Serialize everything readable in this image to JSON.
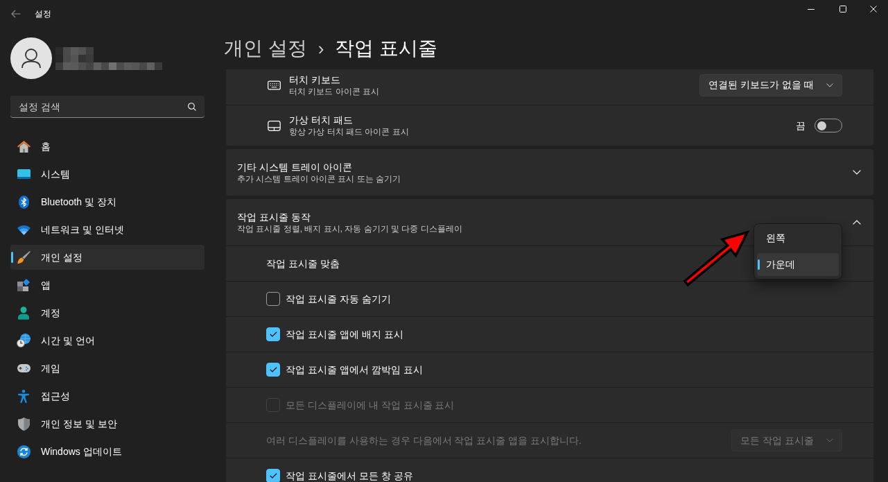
{
  "window": {
    "title": "설정"
  },
  "search": {
    "placeholder": "설정 검색"
  },
  "sidebar": {
    "items": [
      {
        "label": "홈",
        "selected": false
      },
      {
        "label": "시스템",
        "selected": false
      },
      {
        "label": "Bluetooth 및 장치",
        "selected": false
      },
      {
        "label": "네트워크 및 인터넷",
        "selected": false
      },
      {
        "label": "개인 설정",
        "selected": true
      },
      {
        "label": "앱",
        "selected": false
      },
      {
        "label": "계정",
        "selected": false
      },
      {
        "label": "시간 및 언어",
        "selected": false
      },
      {
        "label": "게임",
        "selected": false
      },
      {
        "label": "접근성",
        "selected": false
      },
      {
        "label": "개인 정보 및 보안",
        "selected": false
      },
      {
        "label": "Windows 업데이트",
        "selected": false
      }
    ]
  },
  "breadcrumb": {
    "parent": "개인 설정",
    "separator": "›",
    "current": "작업 표시줄"
  },
  "cards": [
    {
      "kind": "group",
      "rows": [
        {
          "kind": "select",
          "title": "터치 키보드",
          "subtitle": "터치 키보드 아이콘 표시",
          "value": "연결된 키보드가 없을 때"
        },
        {
          "kind": "toggle",
          "title": "가상 터치 패드",
          "subtitle": "항상 가상 터치 패드 아이콘 표시",
          "state_label": "끔",
          "on": false
        }
      ]
    },
    {
      "kind": "expander",
      "title": "기타 시스템 트레이 아이콘",
      "subtitle": "추가 시스템 트레이 아이콘 표시 또는 숨기기",
      "expanded": false
    },
    {
      "kind": "expander",
      "title": "작업 표시줄 동작",
      "subtitle": "작업 표시줄 정렬, 배지 표시, 자동 숨기기 및 다중 디스플레이",
      "expanded": true,
      "rows": [
        {
          "kind": "select",
          "title": "작업 표시줄 맞춤",
          "disabled": false,
          "menu": {
            "open": true,
            "options": [
              {
                "label": "왼쪽",
                "selected": false
              },
              {
                "label": "가운데",
                "selected": true
              }
            ]
          }
        },
        {
          "kind": "checkbox",
          "title": "작업 표시줄 자동 숨기기",
          "checked": false,
          "disabled": false
        },
        {
          "kind": "checkbox",
          "title": "작업 표시줄 앱에 배지 표시",
          "checked": true,
          "disabled": false
        },
        {
          "kind": "checkbox",
          "title": "작업 표시줄 앱에서 깜박임 표시",
          "checked": true,
          "disabled": false
        },
        {
          "kind": "checkbox",
          "title": "모든 디스플레이에 내 작업 표시줄 표시",
          "checked": false,
          "disabled": true
        },
        {
          "kind": "select",
          "title": "여러 디스플레이를 사용하는 경우 다음에서 작업 표시줄 앱을 표시합니다.",
          "value": "모든 작업 표시줄",
          "disabled": true
        },
        {
          "kind": "checkbox",
          "title": "작업 표시줄에서 모든 창 공유",
          "checked": true,
          "disabled": false
        }
      ]
    }
  ]
}
